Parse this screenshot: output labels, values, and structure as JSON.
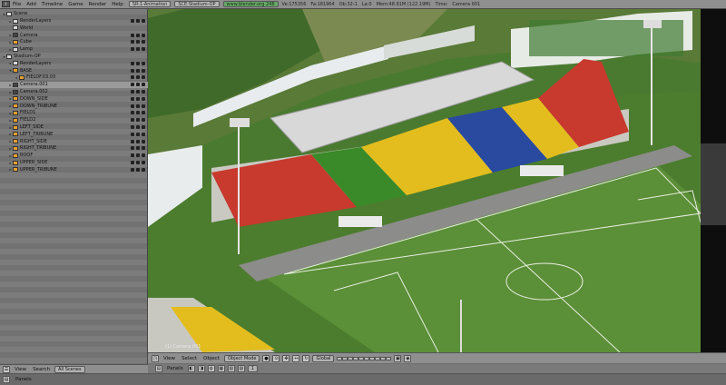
{
  "topbar": {
    "menus": [
      "File",
      "Add",
      "Timeline",
      "Game",
      "Render",
      "Help"
    ],
    "screen": "SR:1-Animation",
    "scene": "SCE:Stadium-OP",
    "url": "www.blender.org 248",
    "stats": [
      "Ve:175356",
      "Fa:181964",
      "Ob:32-1",
      "La:0",
      "Mem:48.91M (122.19M)",
      "Time:",
      "Camera 001"
    ]
  },
  "outliner": {
    "rows": [
      {
        "label": "Scene",
        "depth": 0,
        "tri": "▾",
        "icon": "scene"
      },
      {
        "label": "RenderLayers",
        "depth": 1,
        "tri": "▸",
        "icon": "layers"
      },
      {
        "label": "World",
        "depth": 1,
        "tri": "",
        "icon": "world"
      },
      {
        "label": "Camera",
        "depth": 1,
        "tri": "▸",
        "icon": "camera"
      },
      {
        "label": "Cube",
        "depth": 1,
        "tri": "▸",
        "icon": "mesh"
      },
      {
        "label": "Lamp",
        "depth": 1,
        "tri": "▸",
        "icon": "lamp"
      },
      {
        "label": "Stadium-OP",
        "depth": 0,
        "tri": "▾",
        "icon": "scene"
      },
      {
        "label": "RenderLayers",
        "depth": 1,
        "tri": "▸",
        "icon": "layers"
      },
      {
        "label": "BASE",
        "depth": 1,
        "tri": "▾",
        "icon": "mesh"
      },
      {
        "label": "FIELDF.03.03",
        "depth": 2,
        "tri": "▸",
        "icon": "mesh"
      },
      {
        "label": "Camera.001",
        "depth": 1,
        "tri": "▸",
        "icon": "camera"
      },
      {
        "label": "Camera.002",
        "depth": 1,
        "tri": "▸",
        "icon": "camera"
      },
      {
        "label": "DOWN_SIDE",
        "depth": 1,
        "tri": "▸",
        "icon": "mesh"
      },
      {
        "label": "DOWN_TRIBUNE",
        "depth": 1,
        "tri": "▸",
        "icon": "mesh"
      },
      {
        "label": "FIELD1",
        "depth": 1,
        "tri": "▸",
        "icon": "mesh"
      },
      {
        "label": "FIELD2",
        "depth": 1,
        "tri": "▸",
        "icon": "mesh"
      },
      {
        "label": "LEFT_SIDE",
        "depth": 1,
        "tri": "▸",
        "icon": "mesh"
      },
      {
        "label": "LEFT_TRIBUNE",
        "depth": 1,
        "tri": "▸",
        "icon": "mesh"
      },
      {
        "label": "RIGHT_SIDE",
        "depth": 1,
        "tri": "▸",
        "icon": "mesh"
      },
      {
        "label": "RIGHT_TRIBUNE",
        "depth": 1,
        "tri": "▸",
        "icon": "mesh"
      },
      {
        "label": "ROOF",
        "depth": 1,
        "tri": "▸",
        "icon": "mesh"
      },
      {
        "label": "UPPER_SIDE",
        "depth": 1,
        "tri": "▸",
        "icon": "mesh"
      },
      {
        "label": "UPPER_TRIBUNE",
        "depth": 1,
        "tri": "▸",
        "icon": "mesh"
      }
    ]
  },
  "viewport": {
    "object_label": "(1) Camera.001"
  },
  "vp_header": {
    "view": "View",
    "select": "Select",
    "object": "Object",
    "mode": "Object Mode",
    "orientation": "Global"
  },
  "out_header": {
    "view": "View",
    "search": "Search",
    "filter": "All Scenes"
  },
  "sub_bar": {
    "panels": "Panels",
    "frame": "1"
  },
  "panels_bar": {
    "panels": "Panels"
  },
  "colors": {
    "grass": "#4a7a30",
    "seat_red": "#c83a30",
    "seat_yellow": "#e8c21a",
    "seat_green": "#3a8a2a",
    "seat_blue": "#2a4aa0",
    "roof": "#d8d8d8"
  }
}
